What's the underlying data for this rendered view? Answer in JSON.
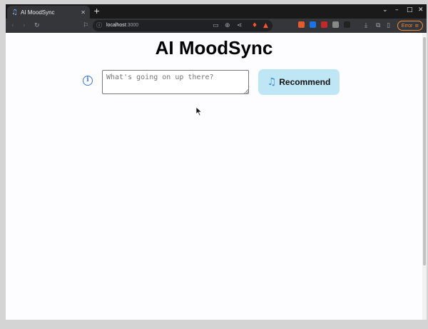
{
  "browser": {
    "tab": {
      "title": "AI MoodSync",
      "icon": "music-note-icon",
      "close": "✕"
    },
    "new_tab": "+",
    "window_controls": {
      "menu": "⌄",
      "minimize": "–",
      "maximize": "□",
      "close": "✕"
    },
    "url": {
      "host": "localhost",
      "port": ":3000"
    },
    "error_button": {
      "label": "Error",
      "icon": "menu-icon"
    },
    "error_color": "#f28b3b"
  },
  "page": {
    "title": "AI MoodSync",
    "input": {
      "placeholder": "What's going on up there?",
      "value": ""
    },
    "recommend_button": {
      "label": "Recommend",
      "icon": "music-note-icon"
    },
    "info_icon": "i",
    "accent_color": "#bfe6f5"
  }
}
